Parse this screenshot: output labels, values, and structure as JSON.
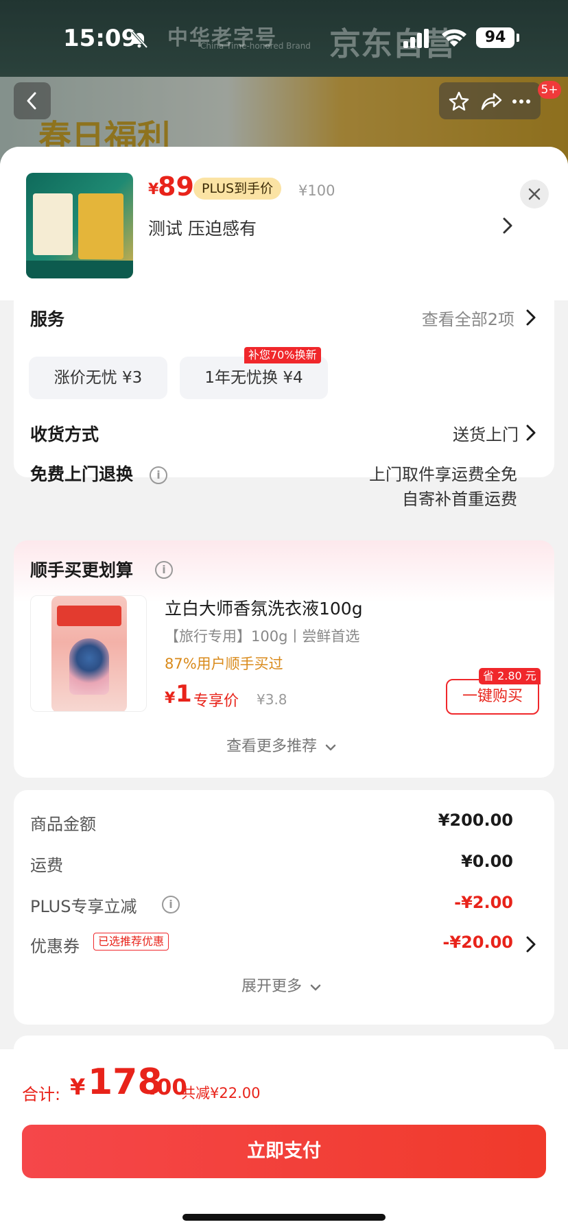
{
  "status_bar": {
    "time": "15:09",
    "battery": "94"
  },
  "background": {
    "brand_cn": "中华老字号",
    "brand_en": "China Time-honored Brand",
    "brand_jd": "京东自营",
    "banner_text": "春日福利",
    "nav_badge": "5+"
  },
  "sku": {
    "price_currency": "¥",
    "price": "89",
    "plus_tag": "PLUS到手价",
    "old_price": "¥100",
    "name": "测试  压迫感有"
  },
  "service": {
    "title": "服务",
    "view_all": "查看全部2项",
    "chips": [
      {
        "label": "涨价无忧   ¥3"
      },
      {
        "label": "1年无忧换   ¥4"
      }
    ],
    "chip_tag": "补您70%换新"
  },
  "delivery": {
    "title": "收货方式",
    "value": "送货上门"
  },
  "return": {
    "title": "免费上门退换",
    "line1": "上门取件享运费全免",
    "line2": "自寄补首重运费"
  },
  "recommend": {
    "title": "顺手买更划算",
    "product": {
      "name": "立白大师香氛洗衣液100g",
      "sub": "【旅行专用】100g丨尝鲜首选",
      "bought": "87%用户顺手买过",
      "price_currency": "¥",
      "price": "1",
      "price_label": "专享价",
      "old_price": "¥3.8",
      "save_tag": "省 2.80 元",
      "buy_label": "一键购买"
    },
    "more": "查看更多推荐"
  },
  "amounts": {
    "rows": [
      {
        "label": "商品金额",
        "value": "¥200.00"
      },
      {
        "label": "运费",
        "value": "¥0.00"
      },
      {
        "label": "PLUS专享立减",
        "value": "-¥2.00"
      },
      {
        "label": "优惠券",
        "value": "-¥20.00"
      }
    ],
    "coupon_tag": "已选推荐优惠",
    "expand": "展开更多"
  },
  "footer": {
    "total_label": "合计:",
    "total_currency": "¥",
    "total_int": "178",
    "total_dec": ".00",
    "saved": "共减¥22.00",
    "pay_label": "立即支付"
  },
  "colors": {
    "accent_red": "#e8231a",
    "plus_gold": "#fbe3a4",
    "bought_orange": "#d98a1b"
  }
}
